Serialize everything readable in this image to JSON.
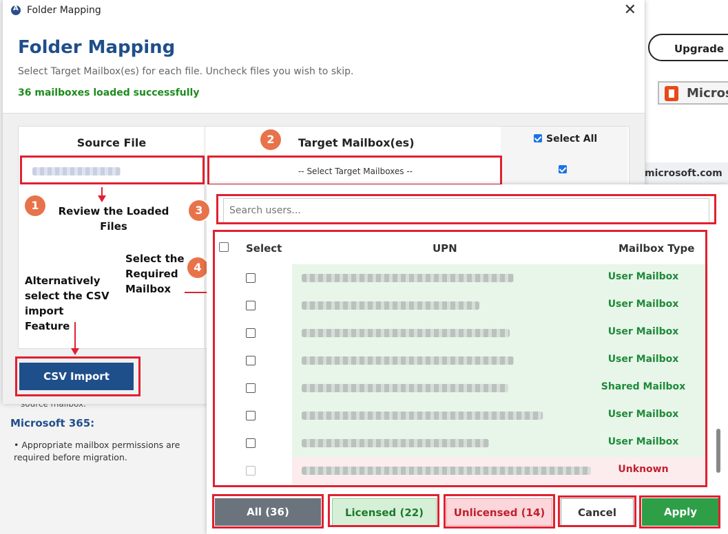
{
  "background": {
    "upgrade_label": "Upgrade Li",
    "microsoft_label": "Micros",
    "domain_suffix": "microsoft.com",
    "prev_text": "source mailbox.",
    "m365_heading": "Microsoft 365:",
    "m365_item": "• Appropriate mailbox permissions are required before migration."
  },
  "dialog": {
    "window_title": "Folder Mapping",
    "close_glyph": "✕",
    "heading": "Folder Mapping",
    "subtitle": "Select Target Mailbox(es) for each file. Uncheck files you wish to skip.",
    "status": "36 mailboxes loaded successfully",
    "columns": {
      "source": "Source File",
      "target": "Target Mailbox(es)",
      "select_all": "Select All"
    },
    "target_placeholder": "-- Select Target Mailboxes --",
    "csv_button": "CSV Import"
  },
  "annotations": {
    "step1_num": "1",
    "step1_text": "Review the Loaded Files",
    "step2_num": "2",
    "step3_num": "3",
    "step4_num": "4",
    "step4_text": "Select the Required Mailbox",
    "alt_text": "Alternatively select the CSV import Feature"
  },
  "panel": {
    "search_placeholder": "Search users...",
    "headers": {
      "select": "Select",
      "upn": "UPN",
      "type": "Mailbox Type"
    },
    "rows": [
      {
        "type": "User Mailbox",
        "status": "licensed"
      },
      {
        "type": "User Mailbox",
        "status": "licensed"
      },
      {
        "type": "User Mailbox",
        "status": "licensed"
      },
      {
        "type": "User Mailbox",
        "status": "licensed"
      },
      {
        "type": "Shared Mailbox",
        "status": "licensed"
      },
      {
        "type": "User Mailbox",
        "status": "licensed"
      },
      {
        "type": "User Mailbox",
        "status": "licensed"
      },
      {
        "type": "Unknown",
        "status": "unlicensed"
      }
    ],
    "filters": {
      "all": "All (36)",
      "licensed": "Licensed (22)",
      "unlicensed": "Unlicensed (14)",
      "cancel": "Cancel",
      "apply": "Apply"
    }
  },
  "colors": {
    "brand_blue": "#1f4f8a",
    "success_green": "#1e8a1e",
    "annotation_red": "#e02030",
    "licensed_bg": "#e8f5e9",
    "unlicensed_bg": "#fdecee",
    "apply_green": "#2e9e47"
  }
}
